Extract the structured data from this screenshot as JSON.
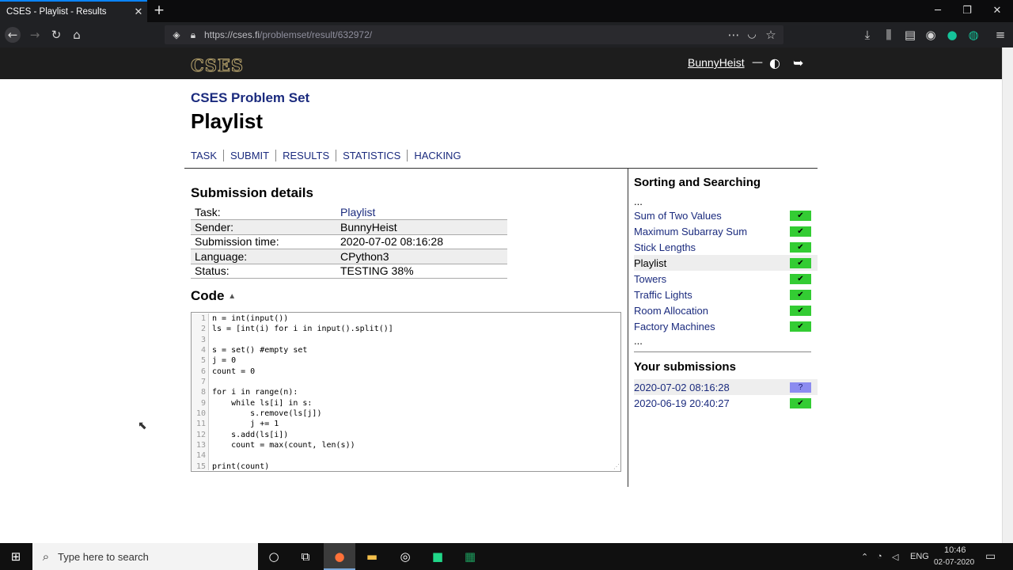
{
  "browser": {
    "tab_title": "CSES - Playlist - Results",
    "tab_close": "✕",
    "new_tab": "+",
    "url_host": "https://cses.fi",
    "url_path": "/problemset/result/632972/"
  },
  "header": {
    "logo": "CSES",
    "username": "BunnyHeist",
    "separator": "—"
  },
  "page": {
    "section": "CSES Problem Set",
    "title": "Playlist",
    "tabs": [
      "TASK",
      "SUBMIT",
      "RESULTS",
      "STATISTICS",
      "HACKING"
    ]
  },
  "submission": {
    "heading": "Submission details",
    "rows": [
      {
        "label": "Task:",
        "value": "Playlist"
      },
      {
        "label": "Sender:",
        "value": "BunnyHeist"
      },
      {
        "label": "Submission time:",
        "value": "2020-07-02 08:16:28"
      },
      {
        "label": "Language:",
        "value": "CPython3"
      },
      {
        "label": "Status:",
        "value": "TESTING 38%"
      }
    ]
  },
  "code": {
    "heading": "Code",
    "toggle": "▲",
    "lines": [
      "n = int(input())",
      "ls = [int(i) for i in input().split()]",
      "",
      "s = set() #empty set",
      "j = 0",
      "count = 0",
      "",
      "for i in range(n):",
      "    while ls[i] in s:",
      "        s.remove(ls[j])",
      "        j += 1",
      "    s.add(ls[i])",
      "    count = max(count, len(s))",
      "",
      "print(count)"
    ],
    "line_numbers": [
      "1",
      "2",
      "3",
      "4",
      "5",
      "6",
      "7",
      "8",
      "9",
      "10",
      "11",
      "12",
      "13",
      "14",
      "15"
    ]
  },
  "sidebar": {
    "heading": "Sorting and Searching",
    "ellipsis": "...",
    "items": [
      {
        "label": "Sum of Two Values",
        "status": "✔"
      },
      {
        "label": "Maximum Subarray Sum",
        "status": "✔"
      },
      {
        "label": "Stick Lengths",
        "status": "✔"
      },
      {
        "label": "Playlist",
        "status": "✔"
      },
      {
        "label": "Towers",
        "status": "✔"
      },
      {
        "label": "Traffic Lights",
        "status": "✔"
      },
      {
        "label": "Room Allocation",
        "status": "✔"
      },
      {
        "label": "Factory Machines",
        "status": "✔"
      }
    ],
    "submissions_heading": "Your submissions",
    "submissions": [
      {
        "time": "2020-07-02 08:16:28",
        "status": "?"
      },
      {
        "time": "2020-06-19 20:40:27",
        "status": "✔"
      }
    ]
  },
  "taskbar": {
    "search_placeholder": "Type here to search",
    "lang": "ENG",
    "time": "10:46",
    "date": "02-07-2020"
  }
}
